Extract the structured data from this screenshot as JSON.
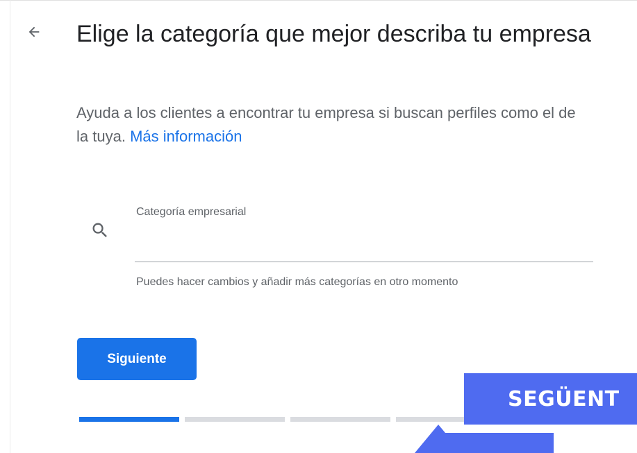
{
  "header": {
    "back_icon": "arrow-left-icon",
    "title": "Elige la categoría que mejor describa tu empresa"
  },
  "intro": {
    "text": "Ayuda a los clientes a encontrar tu empresa si buscan perfiles como el de la tuya.",
    "link_label": "Más información"
  },
  "category_field": {
    "icon": "search-icon",
    "label": "Categoría empresarial",
    "value": "",
    "helper": "Puedes hacer cambios y añadir más categorías en otro momento"
  },
  "actions": {
    "next_label": "Siguiente"
  },
  "progress": {
    "total_steps": 4,
    "current_step": 1
  },
  "annotation": {
    "banner_text": "SEGÜENT",
    "color": "#4f6bf0"
  },
  "colors": {
    "primary": "#1a73e8",
    "secondary_text": "#5f6368",
    "track": "#dadce0"
  }
}
